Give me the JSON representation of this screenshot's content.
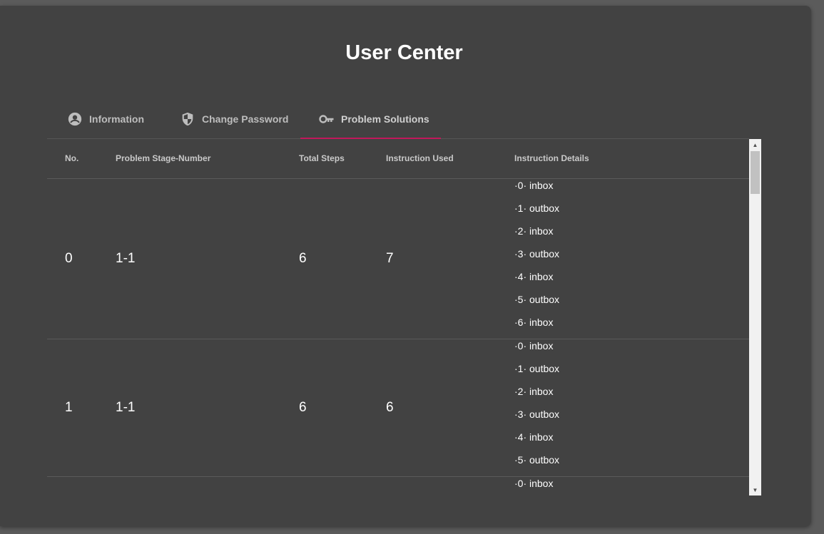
{
  "page": {
    "title": "User Center"
  },
  "tabs": [
    {
      "label": "Information",
      "icon": "account-circle-icon"
    },
    {
      "label": "Change Password",
      "icon": "shield-icon"
    },
    {
      "label": "Problem Solutions",
      "icon": "key-icon"
    }
  ],
  "active_tab": "Problem Solutions",
  "table": {
    "headers": [
      "No.",
      "Problem Stage-Number",
      "Total Steps",
      "Instruction Used",
      "Instruction Details"
    ],
    "rows": [
      {
        "no": "0",
        "stage": "1-1",
        "total_steps": "6",
        "instruction_used": "7",
        "details": [
          "·0· inbox",
          "·1· outbox",
          "·2· inbox",
          "·3· outbox",
          "·4· inbox",
          "·5· outbox",
          "·6· inbox"
        ]
      },
      {
        "no": "1",
        "stage": "1-1",
        "total_steps": "6",
        "instruction_used": "6",
        "details": [
          "·0· inbox",
          "·1· outbox",
          "·2· inbox",
          "·3· outbox",
          "·4· inbox",
          "·5· outbox"
        ]
      },
      {
        "no": "",
        "stage": "",
        "total_steps": "",
        "instruction_used": "",
        "details": [
          "·0· inbox"
        ]
      }
    ]
  },
  "colors": {
    "accent": "#c2185b",
    "card": "#424242"
  }
}
